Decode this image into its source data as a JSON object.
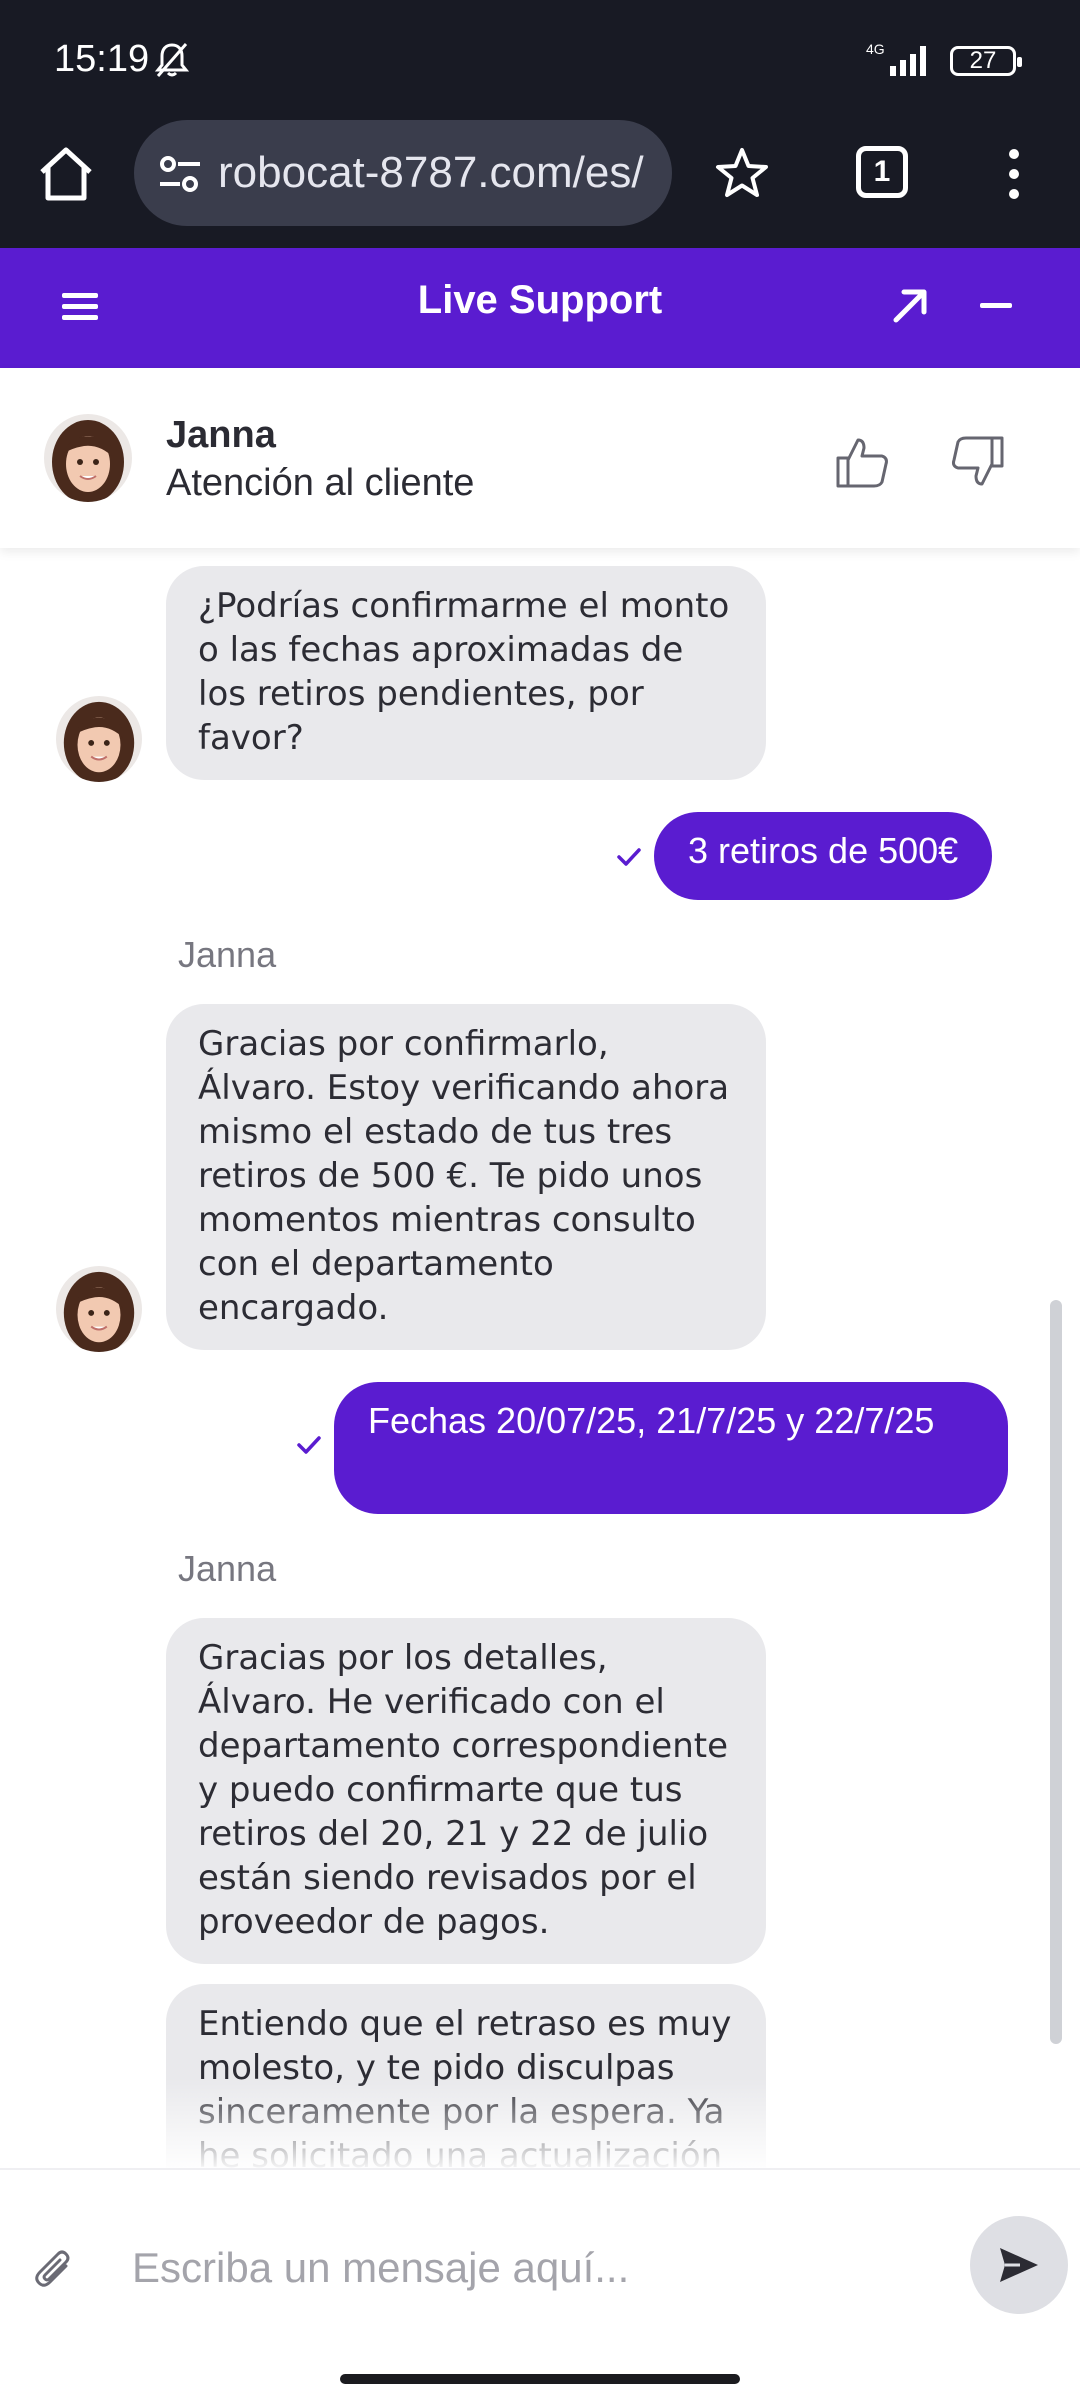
{
  "status_bar": {
    "time": "15:19",
    "network": "4G",
    "battery": "27"
  },
  "browser": {
    "url": "robocat-8787.com/es/",
    "tab_count": "1"
  },
  "chat_header": {
    "title": "Live Support"
  },
  "agent": {
    "name": "Janna",
    "role": "Atención al cliente"
  },
  "messages": [
    {
      "from": "agent",
      "text": "¿Podrías confirmarme el monto o las fechas aproximadas de los retiros pendientes, por favor?"
    },
    {
      "from": "user",
      "text": "3 retiros de 500€"
    },
    {
      "from": "agent",
      "sender": "Janna",
      "text": "Gracias por confirmarlo, Álvaro. Estoy verificando ahora mismo el estado de tus tres retiros de 500 €. Te pido unos momentos mientras consulto con el departamento encargado."
    },
    {
      "from": "user",
      "text": "Fechas 20/07/25, 21/7/25 y 22/7/25"
    },
    {
      "from": "agent",
      "sender": "Janna",
      "text": "Gracias por los detalles, Álvaro. He verificado con el departamento correspondiente y puedo confirmarte que tus retiros del 20, 21 y 22 de julio están siendo revisados por el proveedor de pagos."
    },
    {
      "from": "agent",
      "text": "Entiendo que el retraso es muy molesto, y te pido disculpas sinceramente por la espera. Ya he solicitado una actualización"
    }
  ],
  "input": {
    "placeholder": "Escriba un mensaje aquí...",
    "value": ""
  },
  "colors": {
    "accent": "#5a1cd0",
    "agent_bubble": "#e9e9ec",
    "browser_bar": "#181a24"
  },
  "icons": [
    "bell-off-icon",
    "home-icon",
    "tune-icon",
    "star-icon",
    "more-vert-icon",
    "hamburger-icon",
    "expand-icon",
    "minimize-icon",
    "thumb-up-icon",
    "thumb-down-icon",
    "check-icon",
    "attach-icon",
    "send-icon"
  ]
}
